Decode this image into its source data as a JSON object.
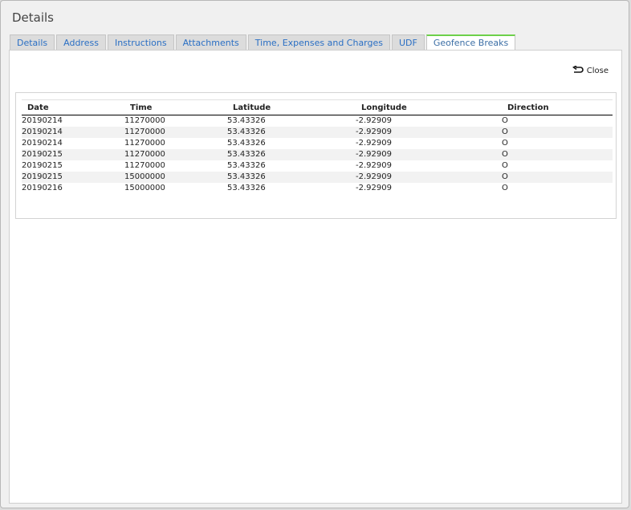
{
  "dialog": {
    "title": "Details"
  },
  "tabs": [
    {
      "label": "Details",
      "active": false
    },
    {
      "label": "Address",
      "active": false
    },
    {
      "label": "Instructions",
      "active": false
    },
    {
      "label": "Attachments",
      "active": false
    },
    {
      "label": "Time, Expenses and Charges",
      "active": false
    },
    {
      "label": "UDF",
      "active": false
    },
    {
      "label": "Geofence Breaks",
      "active": true
    }
  ],
  "toolbar": {
    "close_label": "Close"
  },
  "grid": {
    "columns": [
      "Date",
      "Time",
      "Latitude",
      "Longitude",
      "Direction"
    ],
    "rows": [
      [
        "20190214",
        "11270000",
        "53.43326",
        "-2.92909",
        "O"
      ],
      [
        "20190214",
        "11270000",
        "53.43326",
        "-2.92909",
        "O"
      ],
      [
        "20190214",
        "11270000",
        "53.43326",
        "-2.92909",
        "O"
      ],
      [
        "20190215",
        "11270000",
        "53.43326",
        "-2.92909",
        "O"
      ],
      [
        "20190215",
        "11270000",
        "53.43326",
        "-2.92909",
        "O"
      ],
      [
        "20190215",
        "15000000",
        "53.43326",
        "-2.92909",
        "O"
      ],
      [
        "20190216",
        "15000000",
        "53.43326",
        "-2.92909",
        "O"
      ]
    ]
  },
  "colors": {
    "active_tab_accent": "#6dd04a",
    "tab_text": "#2a6fc4"
  },
  "icons": {
    "close": "undo-arrow-icon"
  }
}
